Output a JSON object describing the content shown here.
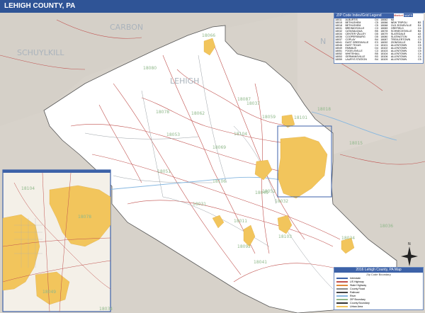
{
  "title": "LEHIGH COUNTY, PA",
  "labels": {
    "carbon": "CARBON",
    "schuylkill": "SCHUYLKILL",
    "lehigh": "LEHIGH",
    "north": "N"
  },
  "zip_labels": [
    "18066",
    "18080",
    "18087",
    "18059",
    "18078",
    "18062",
    "18104",
    "18069",
    "18051",
    "18031",
    "18011",
    "18049",
    "18103",
    "18036",
    "18041",
    "18092",
    "18015",
    "18018",
    "18101",
    "18034",
    "18106",
    "18052",
    "18032",
    "18037",
    "18053"
  ],
  "zip_legend": {
    "header": "ZIP Code Index/Grid Legend",
    "rows": [
      [
        "18011",
        "ALBURTIS",
        "D4",
        "18062",
        "MACUNGIE",
        "D4"
      ],
      [
        "18015",
        "BETHLEHEM",
        "C5",
        "18066",
        "NEW TRIPOLI",
        "B3"
      ],
      [
        "18018",
        "BETHLEHEM",
        "C5",
        "18068",
        "OLD ZIONSVILLE",
        "E4"
      ],
      [
        "18031",
        "BREINIGSVILLE",
        "C3",
        "18069",
        "OREFIELD",
        "C4"
      ],
      [
        "18032",
        "CATASAUQUA",
        "B5",
        "18078",
        "SCHNECKSVILLE",
        "B4"
      ],
      [
        "18034",
        "CENTER VALLEY",
        "D5",
        "18079",
        "SLATEDALE",
        "A3"
      ],
      [
        "18036",
        "COOPERSBURG",
        "D5",
        "18080",
        "SLATINGTON",
        "A3"
      ],
      [
        "18037",
        "COPLAY",
        "B4",
        "18087",
        "TREXLERTOWN",
        "C3"
      ],
      [
        "18041",
        "EAST GREENVILLE",
        "E3",
        "18092",
        "ZIONSVILLE",
        "E4"
      ],
      [
        "18046",
        "EAST TEXAS",
        "C4",
        "18101",
        "ALLENTOWN",
        "C5"
      ],
      [
        "18049",
        "EMMAUS",
        "D4",
        "18102",
        "ALLENTOWN",
        "C5"
      ],
      [
        "18051",
        "FOGELSVILLE",
        "C3",
        "18103",
        "ALLENTOWN",
        "C5"
      ],
      [
        "18052",
        "WHITEHALL",
        "B5",
        "18104",
        "ALLENTOWN",
        "C4"
      ],
      [
        "18053",
        "GERMANSVILLE",
        "B3",
        "18106",
        "ALLENTOWN",
        "C4"
      ],
      [
        "18059",
        "LAURYS STATION",
        "B4",
        "18109",
        "ALLENTOWN",
        "C5"
      ]
    ]
  },
  "map_legend": {
    "header": "2016 Lehigh County, PA Map",
    "subheader": "Zip Code Boundary",
    "items": [
      "Interstate",
      "US Highway",
      "State Highway",
      "County Road",
      "Railroad",
      "River",
      "ZIP Boundary",
      "County Boundary",
      "Urban Area"
    ]
  },
  "logo": {
    "left": "Market",
    "right": "MAPS"
  },
  "colors": {
    "title_bg": "#2f5496",
    "county_fill": "#ffffff",
    "outside_fill": "#d9d4cd",
    "urban": "#f2c55c",
    "road": "#c0504d",
    "inset_border": "#6d8bbf"
  }
}
